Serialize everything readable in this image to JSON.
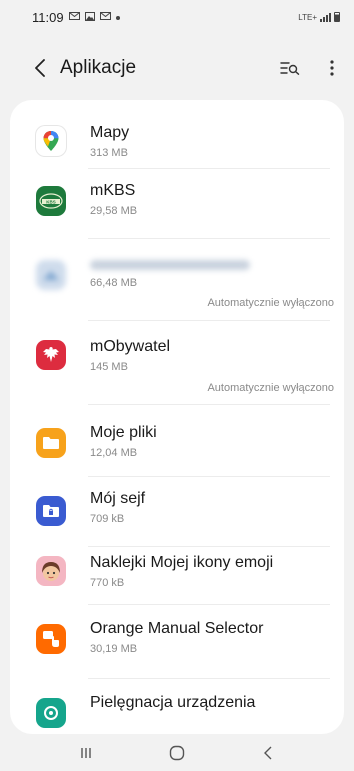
{
  "status_bar": {
    "time": "11:09",
    "icons": [
      "mail-icon",
      "image-icon",
      "mail-icon",
      "dot-icon"
    ],
    "network": "LTE+",
    "signal": "signal-icon",
    "battery": "battery-icon"
  },
  "header": {
    "title": "Aplikacje",
    "back_icon": "back-arrow-icon",
    "search_icon": "filter-search-icon",
    "more_icon": "more-vert-icon"
  },
  "apps": [
    {
      "name": "Mapy",
      "size": "313 MB",
      "status": "",
      "icon": "google-maps-icon",
      "blurred": false
    },
    {
      "name": "mKBS",
      "size": "29,58 MB",
      "status": "",
      "icon": "mkbs-icon",
      "blurred": false
    },
    {
      "name": "",
      "size": "66,48 MB",
      "status": "Automatycznie wyłączono",
      "icon": "blurred-app-icon",
      "blurred": true
    },
    {
      "name": "mObywatel",
      "size": "145 MB",
      "status": "Automatycznie wyłączono",
      "icon": "mobywatel-eagle-icon",
      "blurred": false
    },
    {
      "name": "Moje pliki",
      "size": "12,04 MB",
      "status": "",
      "icon": "my-files-folder-icon",
      "blurred": false
    },
    {
      "name": "Mój sejf",
      "size": "709 kB",
      "status": "",
      "icon": "secure-folder-icon",
      "blurred": false
    },
    {
      "name": "Naklejki Mojej ikony emoji",
      "size": "770 kB",
      "status": "",
      "icon": "ar-emoji-avatar-icon",
      "blurred": false
    },
    {
      "name": "Orange Manual Selector",
      "size": "30,19 MB",
      "status": "",
      "icon": "orange-selector-icon",
      "blurred": false
    },
    {
      "name": "Pielęgnacja urządzenia",
      "size": "",
      "status": "",
      "icon": "device-care-icon",
      "blurred": false
    }
  ],
  "nav_bar": {
    "recents_icon": "recents-icon",
    "home_icon": "home-icon",
    "back_icon": "nav-back-icon"
  },
  "colors": {
    "background": "#f2f2f2",
    "card": "#ffffff",
    "secondary_text": "#8a8a8a"
  }
}
